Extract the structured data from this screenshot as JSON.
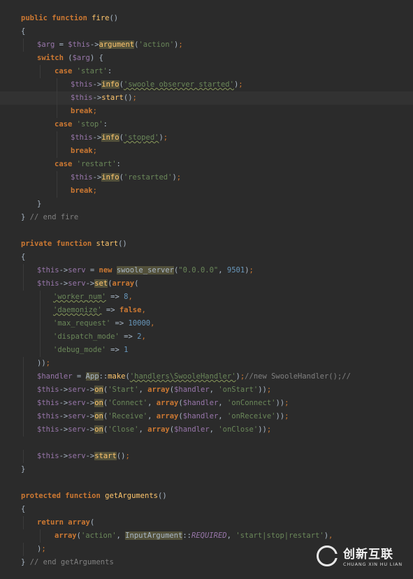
{
  "code": {
    "public_kw": "public",
    "function_kw": "function",
    "private_kw": "private",
    "protected_kw": "protected",
    "fire_fn": "fire",
    "start_fn": "start",
    "getArguments_fn": "getArguments",
    "parens": "()",
    "open_brace": "{",
    "close_brace": "}",
    "arg_var": "$arg",
    "this_var": "$this",
    "handler_var": "$handler",
    "serv_prop": "serv",
    "arrow": "->",
    "argument_fn": "argument",
    "info_fn": "info",
    "set_fn": "set",
    "on_fn": "on",
    "make_fn": "make",
    "switch_kw": "switch",
    "case_kw": "case",
    "break_kw": "break",
    "new_kw": "new",
    "array_kw": "array",
    "false_kw": "false",
    "return_kw": "return",
    "app_class": "App",
    "swoole_server_class": "swoole_server",
    "input_argument_class": "InputArgument",
    "required_const": "REQUIRED",
    "str_action": "'action'",
    "str_start": "'start'",
    "str_stop": "'stop'",
    "str_restart": "'restart'",
    "str_swoole_started": "'swoole observer started'",
    "str_stoped": "'stoped'",
    "str_restarted": "'restarted'",
    "str_ip": "\"0.0.0.0\"",
    "num_port": "9501",
    "str_worker_num": "'worker_num'",
    "num_8": "8",
    "str_daemonize": "'daemonize'",
    "str_max_request": "'max_request'",
    "num_10000": "10000",
    "str_dispatch_mode": "'dispatch_mode'",
    "num_2": "2",
    "str_debug_mode": "'debug_mode'",
    "num_1": "1",
    "str_handlers": "'handlers\\SwooleHandler'",
    "cmt_new_handler": "//new SwooleHandler();//",
    "str_Start": "'Start'",
    "str_onStart": "'onStart'",
    "str_Connect": "'Connect'",
    "str_onConnect": "'onConnect'",
    "str_Receive": "'Receive'",
    "str_onReceive": "'onReceive'",
    "str_Close": "'Close'",
    "str_onClose": "'onClose'",
    "str_start_stop_restart": "'start|stop|restart'",
    "cmt_end_fire": "// end fire",
    "cmt_end_getArguments": "// end getArguments"
  },
  "watermark": {
    "title": "创新互联",
    "subtitle": "CHUANG XIN HU LIAN"
  }
}
